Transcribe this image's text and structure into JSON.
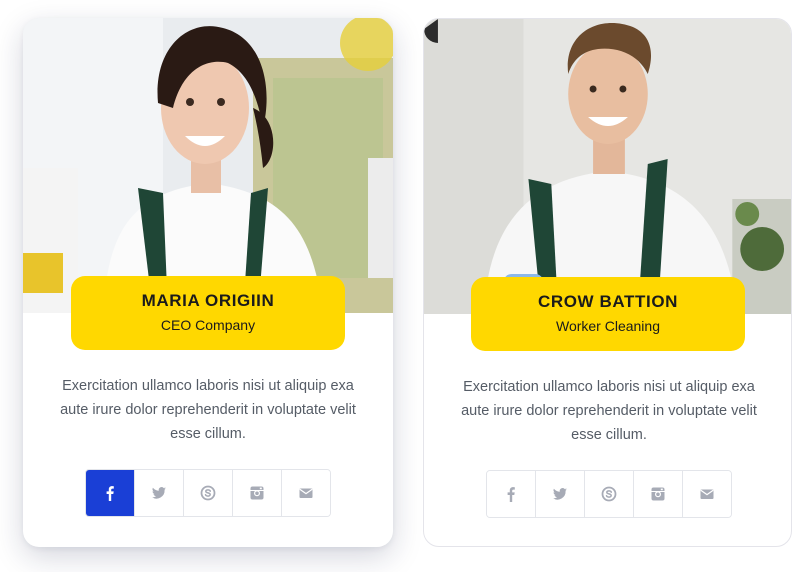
{
  "team": [
    {
      "name": "MARIA ORIGIIN",
      "role": "CEO Company",
      "bio": "Exercitation ullamco laboris nisi ut aliquip exa aute irure dolor reprehenderit in voluptate velit esse cillum.",
      "photo_alt": "maria-photo"
    },
    {
      "name": "CROW BATTION",
      "role": "Worker Cleaning",
      "bio": "Exercitation ullamco laboris nisi ut aliquip exa aute irure dolor reprehenderit in voluptate velit esse cillum.",
      "photo_alt": "crow-photo"
    }
  ],
  "social_icons": [
    "facebook-icon",
    "twitter-icon",
    "skype-icon",
    "instagram-icon",
    "email-icon"
  ],
  "colors": {
    "accent": "#ffd800",
    "active_social": "#1a3fd6",
    "icon_muted": "#a7abb6",
    "text": "#555c66",
    "heading": "#1b1b1b"
  }
}
